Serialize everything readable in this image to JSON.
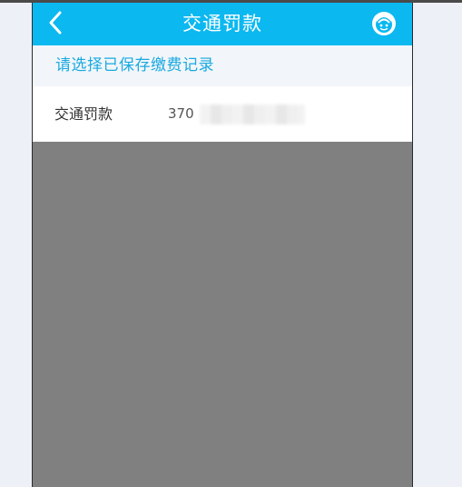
{
  "header": {
    "title": "交通罚款",
    "back_icon": "chevron-left-icon",
    "service_icon": "customer-service-icon"
  },
  "subheader": {
    "text": "请选择已保存缴费记录"
  },
  "records": [
    {
      "label": "交通罚款",
      "number_visible": "370"
    }
  ],
  "colors": {
    "header_bg": "#0bb8f0",
    "subheader_text": "#1aa9e0",
    "overlay": "#808080",
    "page_bg": "#eef0f8"
  }
}
